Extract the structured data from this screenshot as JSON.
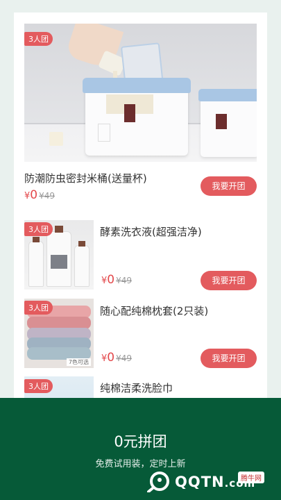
{
  "products": [
    {
      "badge": "3人团",
      "title": "防潮防虫密封米桶(送量杯)",
      "currency": "¥",
      "price": "0",
      "original_price": "¥49",
      "button": "我要开团"
    },
    {
      "badge": "3人团",
      "title": "酵素洗衣液(超强洁净)",
      "currency": "¥",
      "price": "0",
      "original_price": "¥49",
      "button": "我要开团"
    },
    {
      "badge": "3人团",
      "title": "随心配纯棉枕套(2只装)",
      "currency": "¥",
      "price": "0",
      "original_price": "¥49",
      "button": "我要开团",
      "image_caption": "7色可选"
    },
    {
      "badge": "3人团",
      "title": "纯棉洁柔洗脸巾"
    }
  ],
  "bottom_banner": {
    "title": "0元拼团",
    "subtitle": "免费试用装，定时上新"
  },
  "watermark": {
    "text": "QQTN",
    "suffix": ".com",
    "tag": "腾牛网"
  },
  "colors": {
    "accent": "#e35b5e",
    "banner": "#065a38"
  }
}
